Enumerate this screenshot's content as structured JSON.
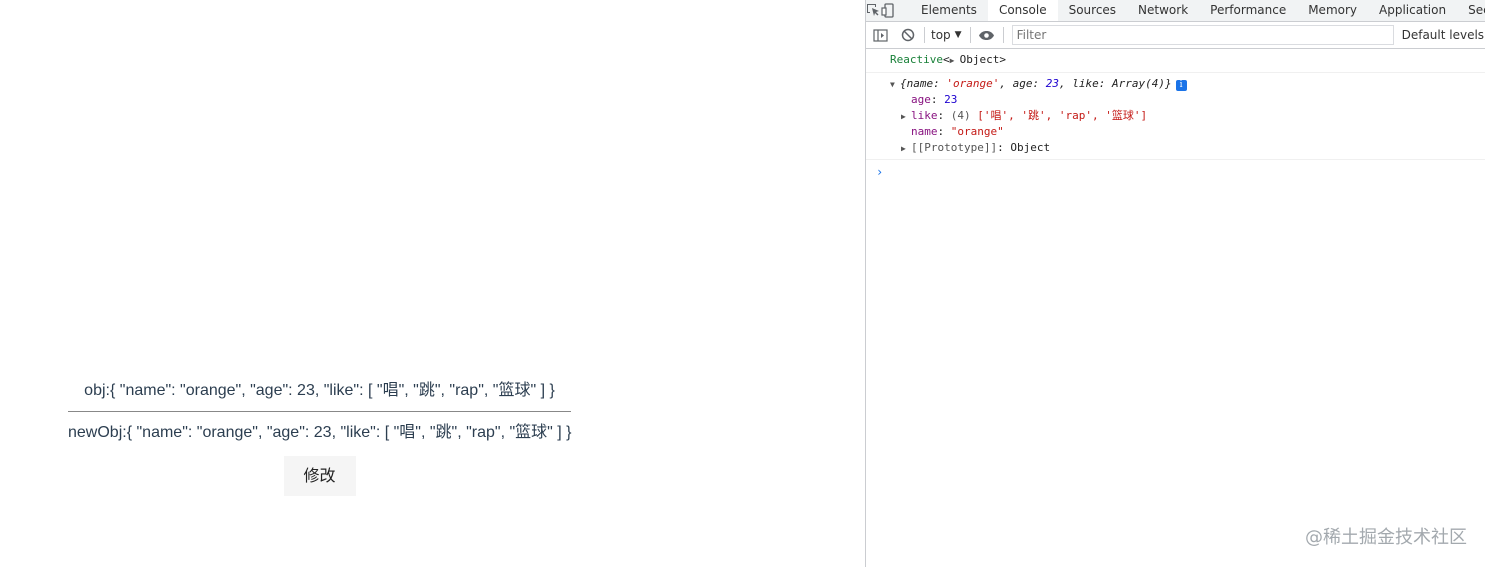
{
  "page": {
    "obj_line": "obj:{ \"name\": \"orange\", \"age\": 23, \"like\": [ \"唱\", \"跳\", \"rap\", \"篮球\" ] }",
    "newobj_line": "newObj:{ \"name\": \"orange\", \"age\": 23, \"like\": [ \"唱\", \"跳\", \"rap\", \"篮球\" ] }",
    "button_label": "修改"
  },
  "devtools": {
    "tabs": [
      "Elements",
      "Console",
      "Sources",
      "Network",
      "Performance",
      "Memory",
      "Application",
      "Secu"
    ],
    "active_tab": "Console",
    "context": "top",
    "filter_placeholder": "Filter",
    "levels": "Default levels",
    "log": {
      "label": "Reactive",
      "lt": "<",
      "object": "Object",
      "gt": ">",
      "summary_open": "{",
      "summary_name_key": "name",
      "summary_name_val": "'orange'",
      "summary_age_key": "age",
      "summary_age_val": "23",
      "summary_like_key": "like",
      "summary_like_val": "Array(4)",
      "summary_close": "}",
      "age_key": "age",
      "age_val": "23",
      "like_key": "like",
      "like_count": "(4)",
      "like_items": "['唱', '跳', 'rap', '篮球']",
      "name_key": "name",
      "name_val": "\"orange\"",
      "proto_key": "[[Prototype]]",
      "proto_val": "Object"
    }
  },
  "watermark": "@稀土掘金技术社区",
  "colors": {
    "accent": "#1a73e8",
    "green": "#188038",
    "key": "#881280",
    "string": "#c41a16"
  }
}
